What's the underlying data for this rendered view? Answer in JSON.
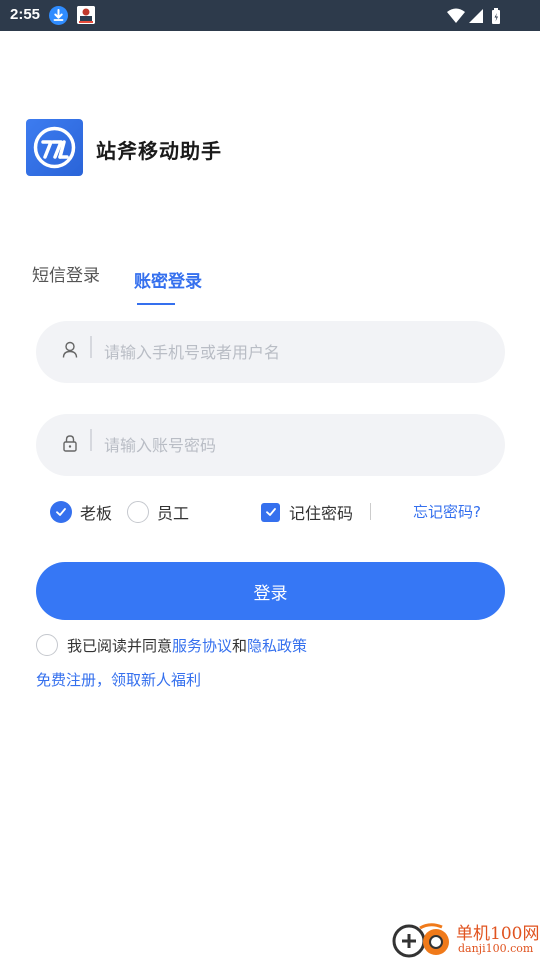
{
  "status_bar": {
    "time": "2:55"
  },
  "app": {
    "name": "站斧移动助手"
  },
  "tabs": [
    {
      "label": "短信登录",
      "active": false
    },
    {
      "label": "账密登录",
      "active": true
    }
  ],
  "form": {
    "username_placeholder": "请输入手机号或者用户名",
    "username_value": "",
    "password_placeholder": "请输入账号密码",
    "password_value": ""
  },
  "roles": [
    {
      "label": "老板",
      "selected": true
    },
    {
      "label": "员工",
      "selected": false
    }
  ],
  "remember": {
    "label": "记住密码",
    "checked": true
  },
  "forgot_label": "忘记密码?",
  "login_label": "登录",
  "agreement": {
    "prefix": "我已阅读并同意",
    "service_link": "服务协议",
    "conjunction": "和",
    "privacy_link": "隐私政策",
    "checked": false
  },
  "register_label": "免费注册，领取新人福利",
  "watermark": {
    "title": "单机100网",
    "url": "danji100.com"
  },
  "colors": {
    "accent": "#3570ee",
    "button": "#3677f5",
    "status_bar": "#2d3a4b",
    "input_bg": "#f2f3f6"
  },
  "icons": {
    "status": [
      "download-icon",
      "app-thumbnail-icon",
      "wifi-icon",
      "signal-icon",
      "battery-icon"
    ],
    "username": "user-icon",
    "password": "lock-icon"
  }
}
